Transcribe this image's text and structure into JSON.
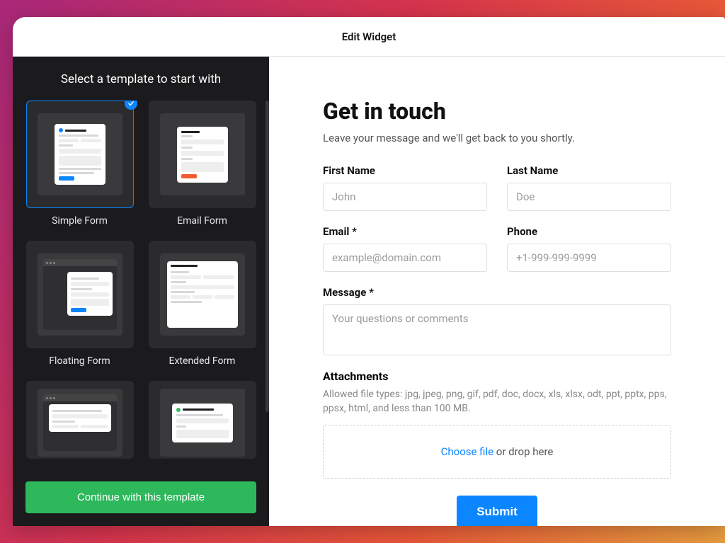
{
  "header": {
    "title": "Edit Widget"
  },
  "sidebar": {
    "title": "Select a template to start with",
    "continue_label": "Continue with this template",
    "templates": [
      {
        "label": "Simple Form"
      },
      {
        "label": "Email Form"
      },
      {
        "label": "Floating Form"
      },
      {
        "label": "Extended Form"
      },
      {
        "label": ""
      },
      {
        "label": ""
      }
    ]
  },
  "form": {
    "title": "Get in touch",
    "subtitle": "Leave your message and we'll get back to you shortly.",
    "fields": {
      "first_name": {
        "label": "First Name",
        "placeholder": "John"
      },
      "last_name": {
        "label": "Last Name",
        "placeholder": "Doe"
      },
      "email": {
        "label": "Email *",
        "placeholder": "example@domain.com"
      },
      "phone": {
        "label": "Phone",
        "placeholder": "+1-999-999-9999"
      },
      "message": {
        "label": "Message *",
        "placeholder": "Your questions or comments"
      }
    },
    "attachments": {
      "label": "Attachments",
      "help": "Allowed file types: jpg, jpeg, png, gif, pdf, doc, docx, xls, xlsx, odt, ppt, pptx, pps, ppsx, html, and less than 100 MB.",
      "choose": "Choose file",
      "drop": " or drop here"
    },
    "submit_label": "Submit"
  }
}
